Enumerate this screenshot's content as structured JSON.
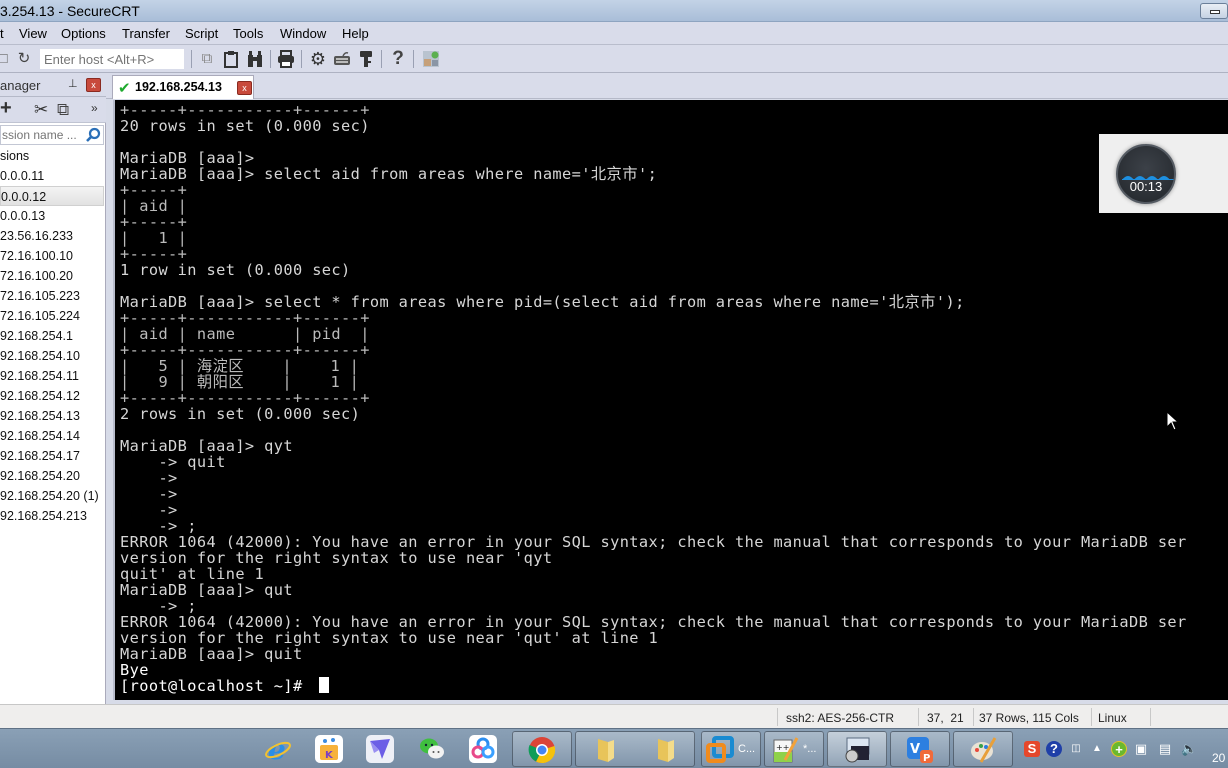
{
  "window": {
    "title": "3.254.13 - SecureCRT"
  },
  "menu": [
    "t",
    "View",
    "Options",
    "Transfer",
    "Script",
    "Tools",
    "Window",
    "Help"
  ],
  "toolbar": {
    "host_placeholder": "Enter host <Alt+R>",
    "icons": [
      "new-session-icon",
      "reconnect-icon",
      "copy-icon",
      "paste-icon",
      "find-icon",
      "print-icon",
      "settings-icon",
      "keymap-icon",
      "key-icon",
      "help-icon",
      "sftp-icon"
    ]
  },
  "session_manager": {
    "title": "anager",
    "pin_glyph": "⩀",
    "close_glyph": "x",
    "search_placeholder": "ssion name ...",
    "root_label": "sions",
    "sessions": [
      "0.0.0.11",
      "0.0.0.12",
      "0.0.0.13",
      "23.56.16.233",
      "72.16.100.10",
      "72.16.100.20",
      "72.16.105.223",
      "72.16.105.224",
      "92.168.254.1",
      "92.168.254.10",
      "92.168.254.11",
      "92.168.254.12",
      "92.168.254.13",
      "92.168.254.14",
      "92.168.254.17",
      "92.168.254.20",
      "92.168.254.20 (1)",
      "92.168.254.213"
    ],
    "selected_index": 1
  },
  "tab": {
    "label": "192.168.254.13",
    "status": "connected",
    "close_glyph": "x"
  },
  "terminal": {
    "lines": [
      "+-----+-----------+------+",
      "20 rows in set (0.000 sec)",
      "",
      "MariaDB [aaa]>",
      "MariaDB [aaa]> select aid from areas where name='北京市';",
      "+-----+",
      "| aid |",
      "+-----+",
      "|   1 |",
      "+-----+",
      "1 row in set (0.000 sec)",
      "",
      "MariaDB [aaa]> select * from areas where pid=(select aid from areas where name='北京市');",
      "+-----+-----------+------+",
      "| aid | name      | pid  |",
      "+-----+-----------+------+",
      "|   5 | 海淀区    |    1 |",
      "|   9 | 朝阳区    |    1 |",
      "+-----+-----------+------+",
      "2 rows in set (0.000 sec)",
      "",
      "MariaDB [aaa]> qyt",
      "    -> quit",
      "    ->",
      "    ->",
      "    ->",
      "    -> ;",
      "ERROR 1064 (42000): You have an error in your SQL syntax; check the manual that corresponds to your MariaDB ser",
      "version for the right syntax to use near 'qyt",
      "quit' at line 1",
      "MariaDB [aaa]> qut",
      "    -> ;",
      "ERROR 1064 (42000): You have an error in your SQL syntax; check the manual that corresponds to your MariaDB ser",
      "version for the right syntax to use near 'qut' at line 1",
      "MariaDB [aaa]> quit",
      "Bye",
      "[root@localhost ~]# "
    ]
  },
  "recorder": {
    "elapsed": "00:13"
  },
  "statusbar": {
    "protocol": "ssh2: AES-256-CTR",
    "cursor_pos": "37,  21",
    "size": "37 Rows, 115 Cols",
    "os": "Linux"
  },
  "taskbar": {
    "apps": [
      {
        "name": "internet-explorer",
        "label": ""
      },
      {
        "name": "kugou-music",
        "label": ""
      },
      {
        "name": "feishu-lark",
        "label": ""
      },
      {
        "name": "wechat",
        "label": ""
      },
      {
        "name": "baidu-netdisk",
        "label": ""
      },
      {
        "name": "chrome",
        "label": ""
      },
      {
        "name": "folder-1",
        "label": ""
      },
      {
        "name": "folder-2",
        "label": ""
      },
      {
        "name": "vmware",
        "label": "C..."
      },
      {
        "name": "notepad-plus-plus",
        "label": "*..."
      },
      {
        "name": "securecrt",
        "label": ""
      },
      {
        "name": "wps-presentation",
        "label": ""
      },
      {
        "name": "paint",
        "label": ""
      }
    ],
    "clock_partial": "20"
  }
}
